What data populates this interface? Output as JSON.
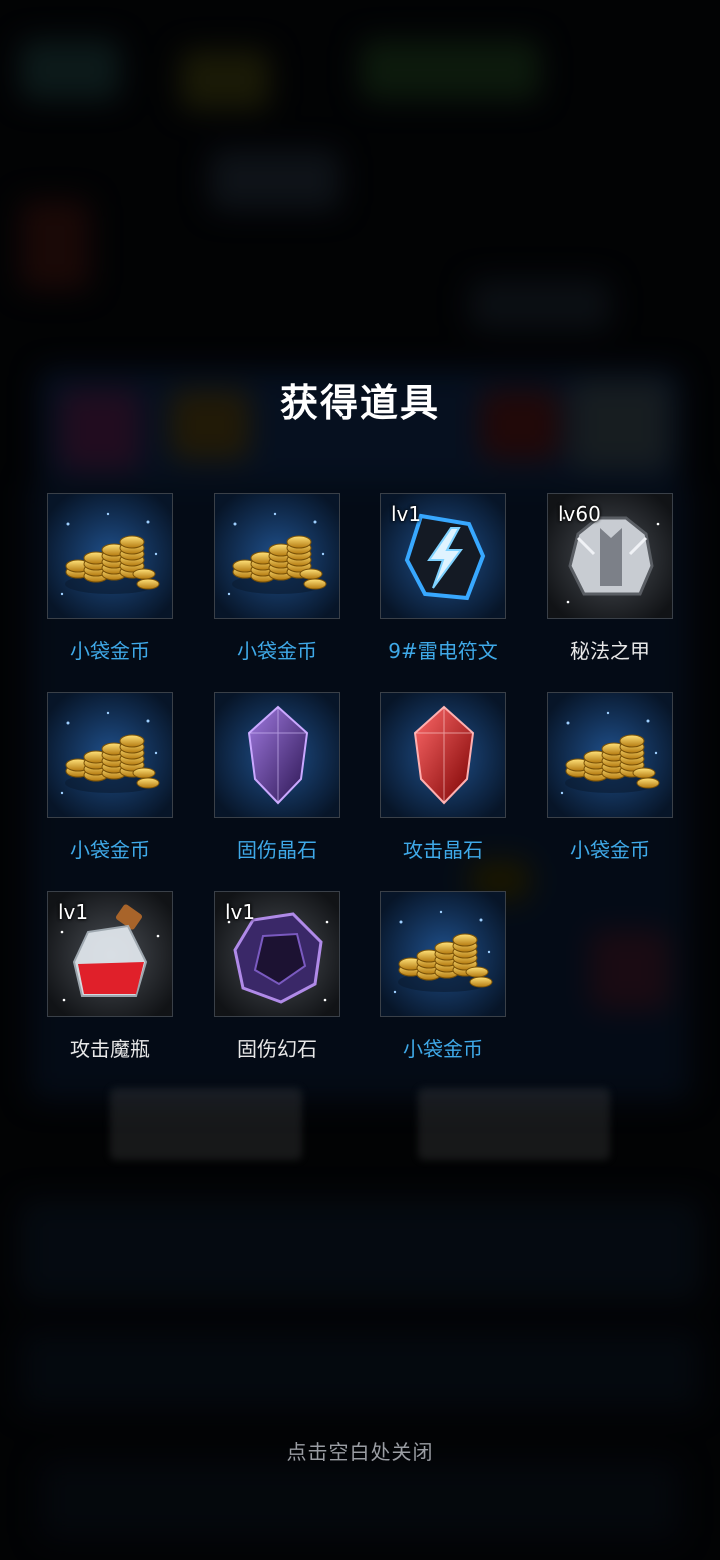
{
  "dialog": {
    "title": "获得道具",
    "close_hint": "点击空白处关闭"
  },
  "colors": {
    "name_blue": "#3fa9e8",
    "name_white": "#e8e8e8",
    "background": "#05070b"
  },
  "items": [
    {
      "name": "小袋金币",
      "level": "",
      "icon": "gold-coins-icon",
      "name_color": "blue",
      "frame": "blue"
    },
    {
      "name": "小袋金币",
      "level": "",
      "icon": "gold-coins-icon",
      "name_color": "blue",
      "frame": "blue"
    },
    {
      "name": "9#雷电符文",
      "level": "lv1",
      "icon": "lightning-rune-icon",
      "name_color": "blue",
      "frame": "blue"
    },
    {
      "name": "秘法之甲",
      "level": "lv60",
      "icon": "armor-icon",
      "name_color": "white",
      "frame": "gray"
    },
    {
      "name": "小袋金币",
      "level": "",
      "icon": "gold-coins-icon",
      "name_color": "blue",
      "frame": "blue"
    },
    {
      "name": "固伤晶石",
      "level": "",
      "icon": "purple-crystal-icon",
      "name_color": "blue",
      "frame": "blue"
    },
    {
      "name": "攻击晶石",
      "level": "",
      "icon": "red-crystal-icon",
      "name_color": "blue",
      "frame": "blue"
    },
    {
      "name": "小袋金币",
      "level": "",
      "icon": "gold-coins-icon",
      "name_color": "blue",
      "frame": "blue"
    },
    {
      "name": "攻击魔瓶",
      "level": "lv1",
      "icon": "potion-bottle-icon",
      "name_color": "white",
      "frame": "gray"
    },
    {
      "name": "固伤幻石",
      "level": "lv1",
      "icon": "purple-stone-icon",
      "name_color": "white",
      "frame": "gray"
    },
    {
      "name": "小袋金币",
      "level": "",
      "icon": "gold-coins-icon",
      "name_color": "blue",
      "frame": "blue"
    }
  ]
}
